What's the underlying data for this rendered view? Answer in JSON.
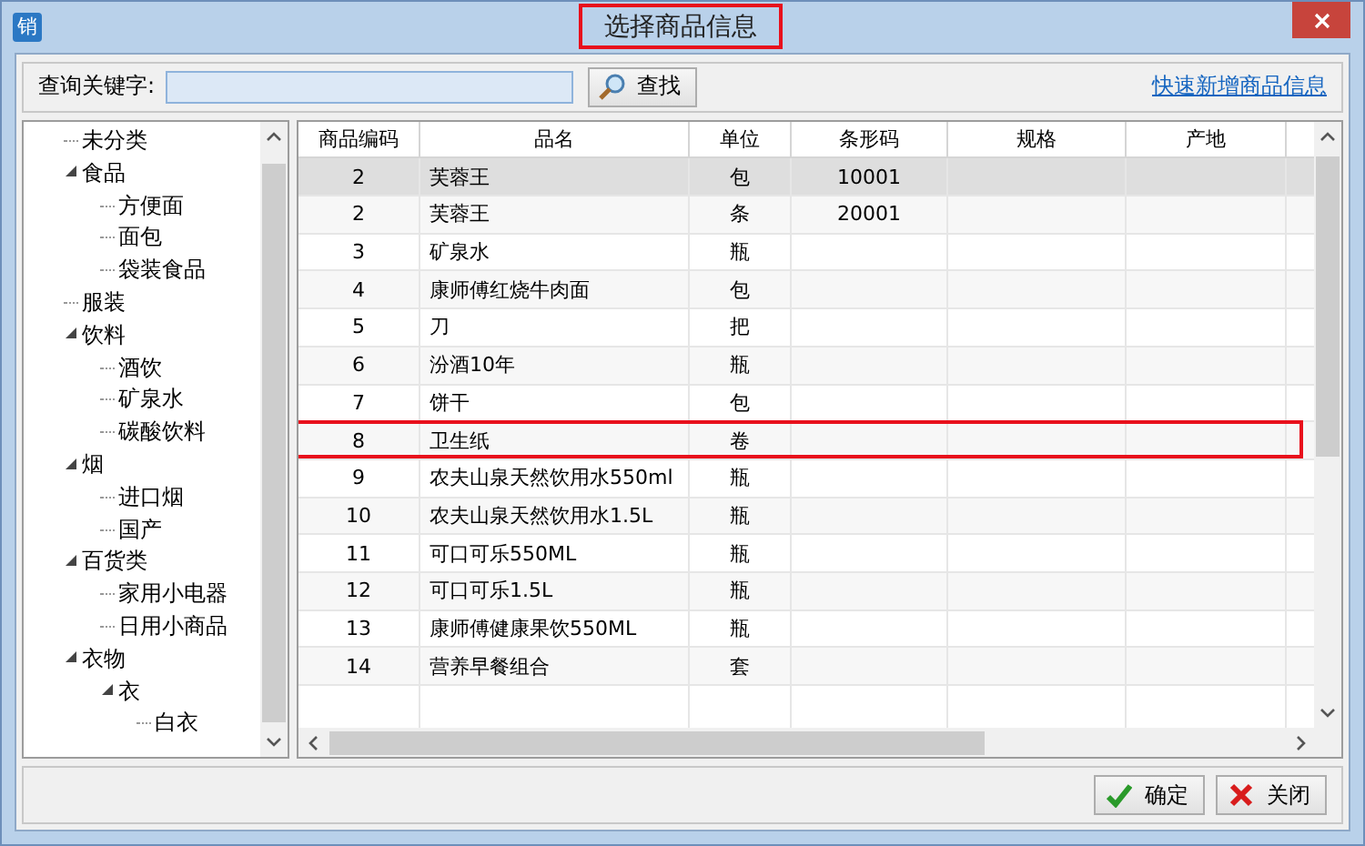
{
  "window": {
    "title": "选择商品信息",
    "title_highlighted": true,
    "app_icon_text": "销"
  },
  "search": {
    "label": "查询关键字:",
    "button": "查找",
    "link": "快速新增商品信息"
  },
  "tree": [
    {
      "label": "未分类"
    },
    {
      "label": "食品",
      "expanded": true,
      "children": [
        {
          "label": "方便面"
        },
        {
          "label": "面包"
        },
        {
          "label": "袋装食品"
        }
      ]
    },
    {
      "label": "服装"
    },
    {
      "label": "饮料",
      "expanded": true,
      "children": [
        {
          "label": "酒饮"
        },
        {
          "label": "矿泉水"
        },
        {
          "label": "碳酸饮料"
        }
      ]
    },
    {
      "label": "烟",
      "expanded": true,
      "children": [
        {
          "label": "进口烟"
        },
        {
          "label": "国产"
        }
      ]
    },
    {
      "label": "百货类",
      "expanded": true,
      "children": [
        {
          "label": "家用小电器"
        },
        {
          "label": "日用小商品"
        }
      ]
    },
    {
      "label": "衣物",
      "expanded": true,
      "children": [
        {
          "label": "衣",
          "expanded": true,
          "children": [
            {
              "label": "白衣"
            }
          ]
        }
      ]
    }
  ],
  "table": {
    "columns": [
      "商品编码",
      "品名",
      "单位",
      "条形码",
      "规格",
      "产地"
    ],
    "rows": [
      {
        "code": "2",
        "name": "芙蓉王",
        "unit": "包",
        "barcode": "10001",
        "selected": true,
        "highlighted": false
      },
      {
        "code": "2",
        "name": "芙蓉王",
        "unit": "条",
        "barcode": "20001",
        "selected": false,
        "highlighted": false
      },
      {
        "code": "3",
        "name": "矿泉水",
        "unit": "瓶",
        "selected": false,
        "highlighted": false
      },
      {
        "code": "4",
        "name": "康师傅红烧牛肉面",
        "unit": "包",
        "selected": false,
        "highlighted": false
      },
      {
        "code": "5",
        "name": "刀",
        "unit": "把",
        "selected": false,
        "highlighted": false
      },
      {
        "code": "6",
        "name": "汾酒10年",
        "unit": "瓶",
        "selected": false,
        "highlighted": false
      },
      {
        "code": "7",
        "name": "饼干",
        "unit": "包",
        "selected": false,
        "highlighted": false
      },
      {
        "code": "8",
        "name": "卫生纸",
        "unit": "卷",
        "selected": false,
        "highlighted": true
      },
      {
        "code": "9",
        "name": "农夫山泉天然饮用水550ml",
        "unit": "瓶",
        "selected": false,
        "highlighted": false
      },
      {
        "code": "10",
        "name": "农夫山泉天然饮用水1.5L",
        "unit": "瓶",
        "selected": false,
        "highlighted": false
      },
      {
        "code": "11",
        "name": "可口可乐550ML",
        "unit": "瓶",
        "selected": false,
        "highlighted": false
      },
      {
        "code": "12",
        "name": "可口可乐1.5L",
        "unit": "瓶",
        "selected": false,
        "highlighted": false
      },
      {
        "code": "13",
        "name": "康师傅健康果饮550ML",
        "unit": "瓶",
        "selected": false,
        "highlighted": false
      },
      {
        "code": "14",
        "name": "营养早餐组合",
        "unit": "套",
        "selected": false,
        "highlighted": false
      }
    ]
  },
  "buttons": [
    {
      "label": "确定",
      "kind": "ok"
    },
    {
      "label": "关闭",
      "kind": "close"
    }
  ]
}
